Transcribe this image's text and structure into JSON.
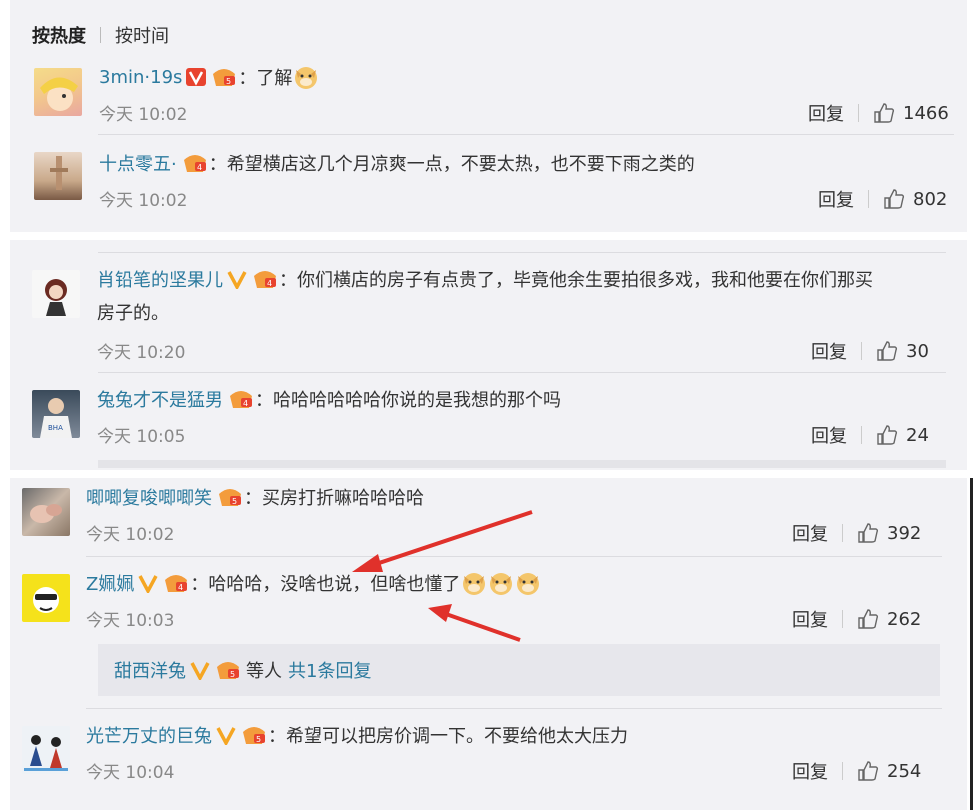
{
  "tabs": {
    "hot": "按热度",
    "time": "按时间"
  },
  "actions": {
    "reply": "回复"
  },
  "comments": [
    {
      "user": "3min·19s",
      "text": "：了解",
      "time": "今天 10:02",
      "likes": "1466"
    },
    {
      "user": "十点零五·",
      "text": "：希望横店这几个月凉爽一点，不要太热，也不要下雨之类的",
      "time": "今天 10:02",
      "likes": "802"
    },
    {
      "user": "肖铅笔的坚果儿",
      "text1": "：你们横店的房子有点贵了，毕竟他余生要拍很多戏，我和他要在你们那买",
      "text2": "房子的。",
      "time": "今天 10:20",
      "likes": "30"
    },
    {
      "user": "兔兔才不是猛男",
      "text": "：哈哈哈哈哈哈你说的是我想的那个吗",
      "time": "今天 10:05",
      "likes": "24"
    },
    {
      "user": "唧唧复唆唧唧笑",
      "text": "：买房打折嘛哈哈哈哈",
      "time": "今天 10:02",
      "likes": "392"
    },
    {
      "user": "Z姵姵",
      "text": "：哈哈哈，没啥也说，但啥也懂了",
      "time": "今天 10:03",
      "likes": "262"
    },
    {
      "user": "光芒万丈的巨兔",
      "text": "：希望可以把房价调一下。不要给他太大压力",
      "time": "今天 10:04",
      "likes": "254"
    }
  ],
  "reply_summary": {
    "user": "甜西洋兔",
    "suffix": "等人",
    "count": "共1条回复"
  },
  "colors": {
    "username": "#2b7a9e",
    "vip_badge": "#f5a623",
    "arrow": "#e0312b"
  }
}
